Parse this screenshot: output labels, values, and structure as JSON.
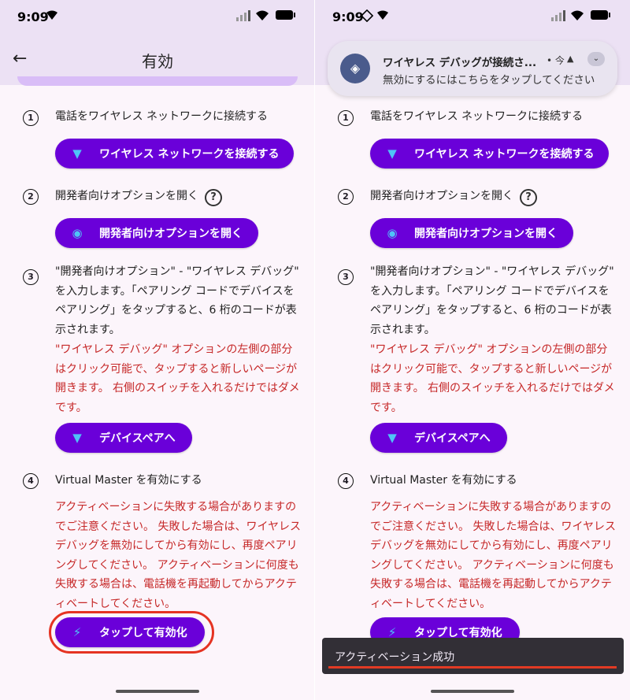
{
  "status": {
    "time": "9:09"
  },
  "app": {
    "title": "有効",
    "back_icon": "arrow-left-icon"
  },
  "steps": [
    {
      "num": "1",
      "text": "電話をワイヤレス ネットワークに接続する",
      "button": "ワイヤレス ネットワークを接続する",
      "icon": "wifi-icon"
    },
    {
      "num": "2",
      "text": "開発者向けオプションを開く",
      "help": "?",
      "button": "開発者向けオプションを開く",
      "icon": "android-icon"
    },
    {
      "num": "3",
      "text": "\"開発者向けオプション\" - \"ワイヤレス デバッグ\" を入力します。「ペアリング コードでデバイスをペアリング」をタップすると、6 桁のコードが表示されます。",
      "warning": "\"ワイヤレス デバッグ\" オプションの左側の部分はクリック可能で、タップすると新しいページが開きます。 右側のスイッチを入れるだけではダメです。",
      "button": "デバイスペアへ",
      "icon": "wifi-icon"
    },
    {
      "num": "4",
      "text": "Virtual Master を有効にする",
      "warning": "アクティベーションに失敗する場合がありますのでご注意ください。 失敗した場合は、ワイヤレス デバッグを無効にしてから有効にし、再度ペアリングしてください。 アクティベーションに何度も失敗する場合は、電話機を再起動してからアクティベートしてください。",
      "button": "タップして有効化",
      "icon": "bolt-icon"
    }
  ],
  "notification": {
    "title": "ワイヤレス デバッグが接続さ...",
    "time": "• 今",
    "subtitle": "無効にするにはこちらをタップしてください"
  },
  "snackbar": {
    "text": "アクティベーション成功"
  },
  "colors": {
    "accent": "#6a00d9",
    "warning": "#c62828",
    "highlight": "#e53322"
  }
}
